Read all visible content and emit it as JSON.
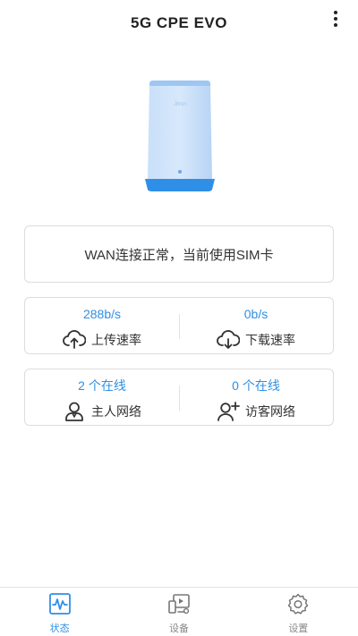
{
  "header": {
    "title": "5G CPE EVO",
    "menu_icon": "more-vertical-icon"
  },
  "device": {
    "image": "router-device-image",
    "logo_text": "Jitron"
  },
  "status": {
    "message": "WAN连接正常，当前使用SIM卡"
  },
  "speed": {
    "upload": {
      "value": "288b/s",
      "label": "上传速率",
      "icon": "cloud-upload-icon"
    },
    "download": {
      "value": "0b/s",
      "label": "下载速率",
      "icon": "cloud-download-icon"
    }
  },
  "network": {
    "host": {
      "value": "2 个在线",
      "label": "主人网络",
      "icon": "user-icon"
    },
    "guest": {
      "value": "0 个在线",
      "label": "访客网络",
      "icon": "add-user-icon"
    }
  },
  "tabs": [
    {
      "label": "状态",
      "icon": "status-pulse-icon",
      "active": true
    },
    {
      "label": "设备",
      "icon": "devices-icon",
      "active": false
    },
    {
      "label": "设置",
      "icon": "settings-gear-icon",
      "active": false
    }
  ],
  "colors": {
    "accent": "#2f8fe6",
    "device_body": "#bcd9f8",
    "device_base": "#2f8fe6",
    "border": "#dcdcdc"
  }
}
